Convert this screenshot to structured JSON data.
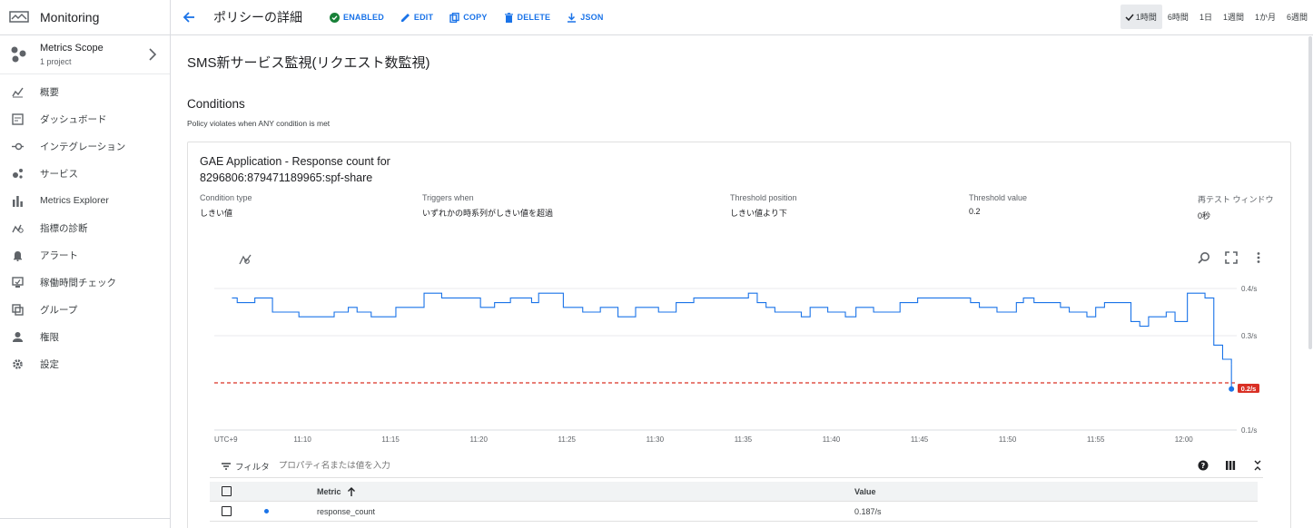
{
  "app": {
    "title": "Monitoring"
  },
  "scope": {
    "title": "Metrics Scope",
    "subtitle": "1 project"
  },
  "nav": [
    {
      "label": "概要",
      "icon": "overview-icon"
    },
    {
      "label": "ダッシュボード",
      "icon": "dashboard-icon"
    },
    {
      "label": "インテグレーション",
      "icon": "integration-icon"
    },
    {
      "label": "サービス",
      "icon": "services-icon"
    },
    {
      "label": "Metrics Explorer",
      "icon": "bar-chart-icon"
    },
    {
      "label": "指標の診断",
      "icon": "diagnostics-icon"
    },
    {
      "label": "アラート",
      "icon": "bell-icon"
    },
    {
      "label": "稼働時間チェック",
      "icon": "uptime-icon"
    },
    {
      "label": "グループ",
      "icon": "groups-icon"
    },
    {
      "label": "権限",
      "icon": "person-icon"
    },
    {
      "label": "設定",
      "icon": "gear-icon"
    }
  ],
  "header": {
    "title": "ポリシーの詳細",
    "actions": {
      "enabled": "ENABLED",
      "edit": "EDIT",
      "copy": "COPY",
      "delete": "DELETE",
      "json": "JSON"
    },
    "time_ranges": [
      "1時間",
      "6時間",
      "1日",
      "1週間",
      "1か月",
      "6週間"
    ],
    "selected_range": "1時間"
  },
  "policy": {
    "name": "SMS新サービス監視(リクエスト数監視)",
    "conditions_heading": "Conditions",
    "conditions_sub": "Policy violates when ANY condition is met",
    "condition": {
      "title_line1": "GAE Application - Response count for",
      "title_line2": "8296806:879471189965:spf-share",
      "type_label": "Condition type",
      "type_value": "しきい値",
      "triggers_label": "Triggers when",
      "triggers_value": "いずれかの時系列がしきい値を超過",
      "threshold_pos_label": "Threshold position",
      "threshold_pos_value": "しきい値より下",
      "threshold_val_label": "Threshold value",
      "threshold_val_value": "0.2",
      "retest_label": "再テスト ウィンドウ",
      "retest_value": "0秒"
    }
  },
  "chart_data": {
    "type": "line",
    "series": [
      {
        "name": "response_count",
        "color": "#1a73e8"
      }
    ],
    "timezone_label": "UTC+9",
    "x_ticks": [
      "11:10",
      "11:15",
      "11:20",
      "11:25",
      "11:30",
      "11:35",
      "11:40",
      "11:45",
      "11:50",
      "11:55",
      "12:00"
    ],
    "y_ticks": [
      "0.4/s",
      "0.3/s",
      "0.1/s"
    ],
    "ylim": [
      0.1,
      0.4
    ],
    "threshold": {
      "value": 0.2,
      "label": "0.2/s",
      "color": "#d93025"
    },
    "x_minutes": [
      6.0,
      6.3,
      6.8,
      7.3,
      7.6,
      8.3,
      9.8,
      10.4,
      11.2,
      11.8,
      12.6,
      13.1,
      13.9,
      14.8,
      15.3,
      15.8,
      16.4,
      16.9,
      17.4,
      17.9,
      19.0,
      19.5,
      20.1,
      20.9,
      21.3,
      21.8,
      22.3,
      23.0,
      23.4,
      23.8,
      24.3,
      24.8,
      25.4,
      25.9,
      26.4,
      26.9,
      27.9,
      28.4,
      28.9,
      29.4,
      29.7,
      30.2,
      30.7,
      31.2,
      31.7,
      32.2,
      32.7,
      33.3,
      34.3,
      34.8,
      35.3,
      35.8,
      36.3,
      36.8,
      37.3,
      38.3,
      38.8,
      39.3,
      39.8,
      40.3,
      40.8,
      41.4,
      41.9,
      42.4,
      43.4,
      43.9,
      44.4,
      44.9,
      45.9,
      46.4,
      46.9,
      47.4,
      47.9,
      48.4,
      48.9,
      49.4,
      49.9,
      50.5,
      50.9,
      51.5,
      52.0,
      52.5,
      53.0,
      53.5,
      54.0,
      54.5,
      55.0,
      55.5,
      56.0,
      56.5,
      57.0,
      57.5,
      58.0,
      58.5,
      59.0,
      59.5,
      60.2,
      60.7,
      61.2,
      61.7,
      62.2,
      62.7
    ],
    "values": [
      0.38,
      0.37,
      0.37,
      0.38,
      0.38,
      0.35,
      0.34,
      0.34,
      0.34,
      0.35,
      0.36,
      0.35,
      0.34,
      0.34,
      0.36,
      0.36,
      0.36,
      0.39,
      0.39,
      0.38,
      0.38,
      0.38,
      0.36,
      0.37,
      0.37,
      0.38,
      0.38,
      0.37,
      0.39,
      0.39,
      0.39,
      0.36,
      0.36,
      0.35,
      0.35,
      0.36,
      0.34,
      0.34,
      0.36,
      0.36,
      0.36,
      0.35,
      0.35,
      0.37,
      0.37,
      0.38,
      0.38,
      0.38,
      0.38,
      0.38,
      0.39,
      0.37,
      0.36,
      0.35,
      0.35,
      0.34,
      0.36,
      0.36,
      0.35,
      0.35,
      0.34,
      0.36,
      0.36,
      0.35,
      0.35,
      0.37,
      0.37,
      0.38,
      0.38,
      0.38,
      0.38,
      0.38,
      0.37,
      0.36,
      0.36,
      0.35,
      0.35,
      0.37,
      0.38,
      0.37,
      0.37,
      0.37,
      0.36,
      0.35,
      0.35,
      0.34,
      0.36,
      0.37,
      0.37,
      0.37,
      0.33,
      0.32,
      0.34,
      0.34,
      0.35,
      0.33,
      0.39,
      0.39,
      0.38,
      0.28,
      0.25,
      0.24
    ],
    "last_point": {
      "x_minute": 62.7,
      "value": 0.187
    }
  },
  "table": {
    "filter_label": "フィルタ",
    "filter_placeholder": "プロパティ名または値を入力",
    "headers": {
      "metric": "Metric",
      "value": "Value"
    },
    "rows": [
      {
        "metric": "response_count",
        "value": "0.187/s",
        "color": "#1a73e8"
      }
    ]
  }
}
